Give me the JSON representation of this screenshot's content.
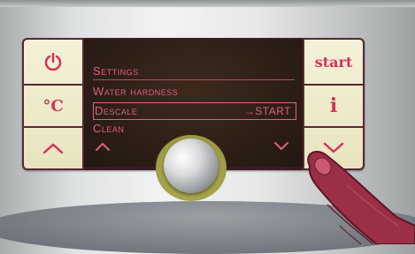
{
  "colors": {
    "panel_border": "#5a2733",
    "key_face": "#f0ecd0",
    "icon_accent": "#d2345a",
    "display_text": "#e06080",
    "display_bg": "#2a1d15"
  },
  "left_keys": [
    {
      "icon": "power-icon"
    },
    {
      "label": "°C",
      "icon": "temperature-icon"
    },
    {
      "icon": "chevron-up-icon"
    }
  ],
  "right_keys": [
    {
      "label": "start"
    },
    {
      "label": "i",
      "icon": "info-icon"
    },
    {
      "icon": "chevron-down-icon"
    }
  ],
  "display": {
    "menu": [
      {
        "label": "Settings"
      },
      {
        "label": "Water hardness"
      },
      {
        "label": "Descale",
        "action": "→START",
        "selected": true
      },
      {
        "label": "Clean"
      }
    ],
    "nav": {
      "up_icon": "chevron-up-icon",
      "down_icon": "chevron-down-icon"
    }
  }
}
